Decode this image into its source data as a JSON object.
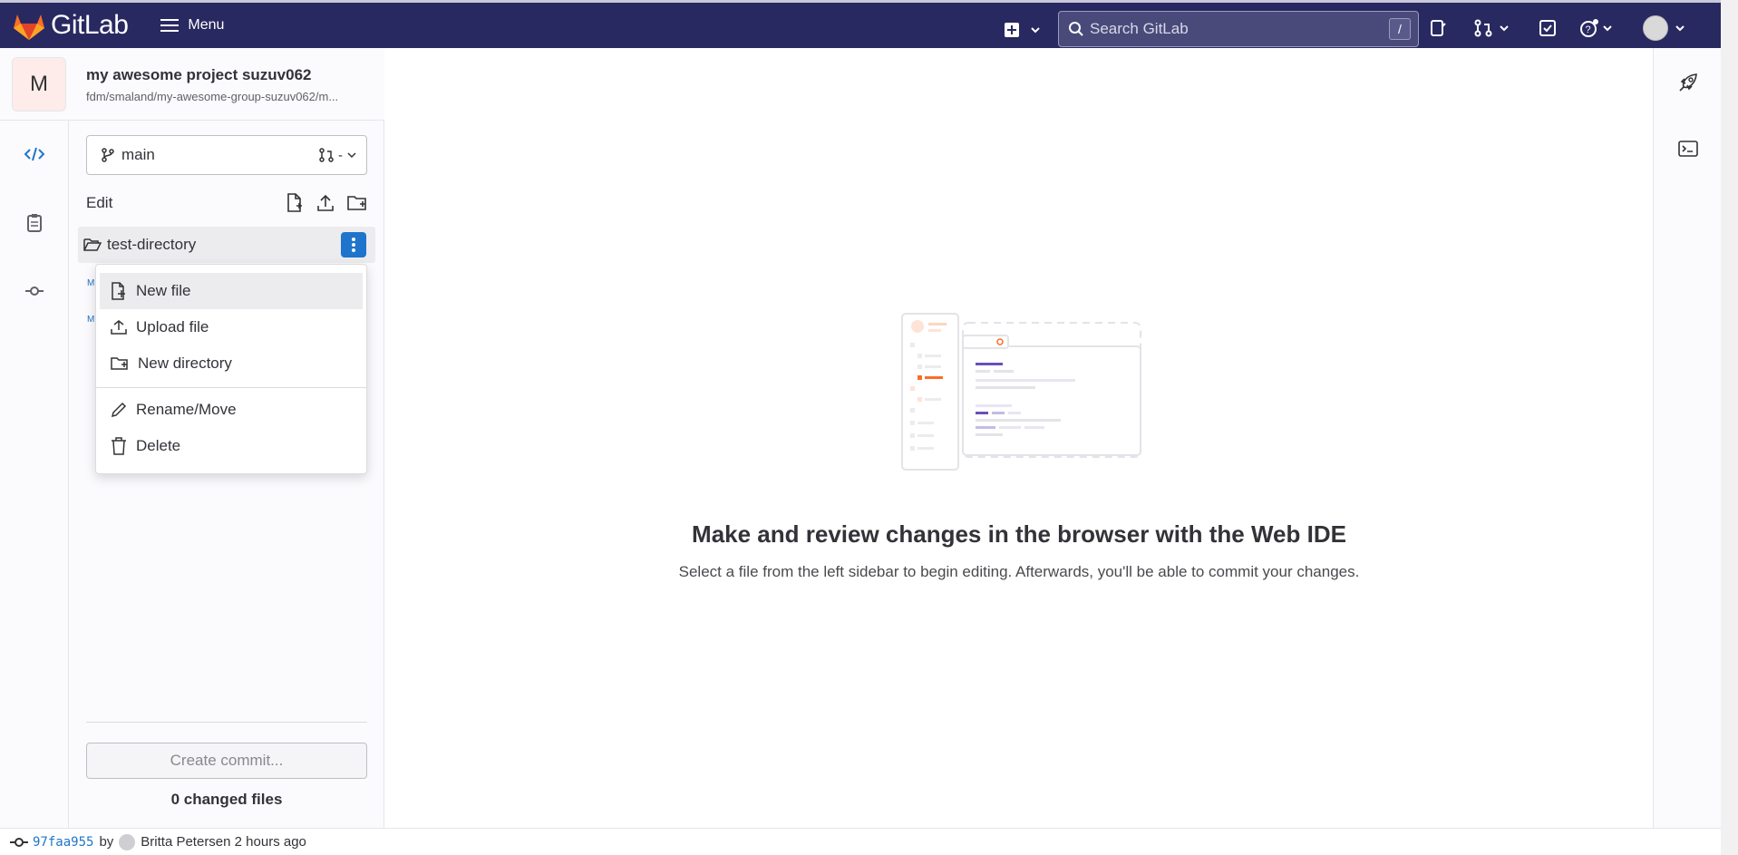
{
  "topbar": {
    "logo_text": "GitLab",
    "menu_label": "Menu",
    "search_placeholder": "Search GitLab",
    "search_shortcut": "/"
  },
  "project": {
    "avatar_letter": "M",
    "name": "my awesome project suzuv062",
    "path": "fdm/smaland/my-awesome-group-suzuv062/m..."
  },
  "sidebar": {
    "branch": "main",
    "branch_mr": "-",
    "edit_label": "Edit",
    "tree": [
      {
        "label": "test-directory"
      }
    ],
    "faint_items": [
      "M",
      "M"
    ]
  },
  "dropdown": {
    "items": [
      {
        "label": "New file",
        "icon": "new-file-icon"
      },
      {
        "label": "Upload file",
        "icon": "upload-icon"
      },
      {
        "label": "New directory",
        "icon": "new-folder-icon"
      },
      {
        "label": "Rename/Move",
        "icon": "pencil-icon"
      },
      {
        "label": "Delete",
        "icon": "trash-icon"
      }
    ]
  },
  "commit": {
    "button_label": "Create commit...",
    "changed_files": "0 changed files"
  },
  "main": {
    "title": "Make and review changes in the browser with the Web IDE",
    "subtitle": "Select a file from the left sidebar to begin editing. Afterwards, you'll be able to commit your changes."
  },
  "statusbar": {
    "commit_hash": "97faa955",
    "by": "by",
    "author_time": "Britta Petersen 2 hours ago"
  },
  "colors": {
    "topbar": "#292961",
    "accent": "#1f75cb",
    "logo_orange": "#fc6d26"
  }
}
